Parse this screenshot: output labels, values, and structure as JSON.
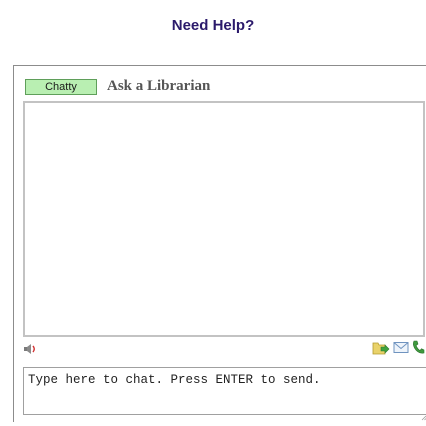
{
  "page": {
    "title": "Need Help?"
  },
  "chat": {
    "status": "Chatty",
    "title": "Ask a Librarian",
    "input_placeholder": "Type here to chat. Press ENTER to send."
  },
  "icons": {
    "sound": "speaker-icon",
    "file": "send-file-icon",
    "email": "email-transcript-icon",
    "phone": "phone-icon"
  },
  "colors": {
    "title_text": "#2b1a6b",
    "status_bg": "#b9efb2",
    "status_border": "#5f9f5a"
  }
}
